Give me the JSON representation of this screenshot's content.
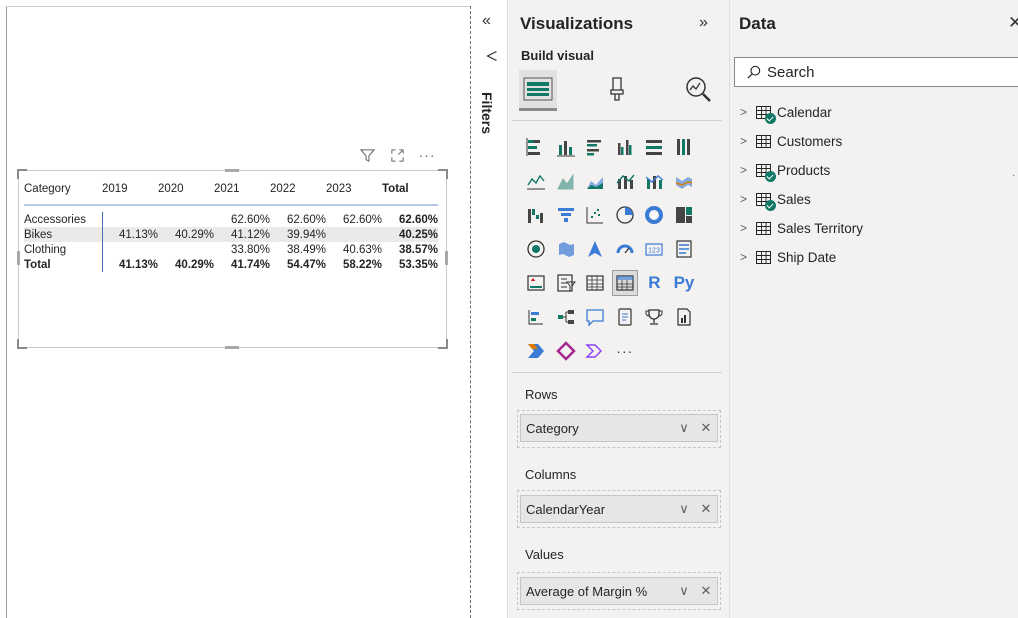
{
  "matrix": {
    "headers": [
      "Category",
      "2019",
      "2020",
      "2021",
      "2022",
      "2023",
      "Total"
    ],
    "rows": [
      {
        "label": "Accessories",
        "values": [
          "",
          "",
          "62.60%",
          "62.60%",
          "62.60%",
          "62.60%"
        ]
      },
      {
        "label": "Bikes",
        "values": [
          "41.13%",
          "40.29%",
          "41.12%",
          "39.94%",
          "",
          "40.25%"
        ]
      },
      {
        "label": "Clothing",
        "values": [
          "",
          "",
          "33.80%",
          "38.49%",
          "40.63%",
          "38.57%"
        ]
      },
      {
        "label": "Total",
        "values": [
          "41.13%",
          "40.29%",
          "41.74%",
          "54.47%",
          "58.22%",
          "53.35%"
        ]
      }
    ]
  },
  "filters": {
    "label": "Filters"
  },
  "visualizations": {
    "title": "Visualizations",
    "build_label": "Build visual",
    "icons": [
      "stacked-bar-icon",
      "stacked-column-icon",
      "clustered-bar-icon",
      "clustered-column-icon",
      "100-stacked-bar-icon",
      "100-stacked-column-icon",
      "line-chart-icon",
      "area-chart-icon",
      "stacked-area-icon",
      "line-clustered-column-icon",
      "line-stacked-column-icon",
      "ribbon-chart-icon",
      "waterfall-icon",
      "funnel-icon",
      "scatter-icon",
      "pie-chart-icon",
      "donut-chart-icon",
      "treemap-icon",
      "map-icon",
      "filled-map-icon",
      "azure-map-icon",
      "gauge-icon",
      "card-icon",
      "multi-row-card-icon",
      "kpi-icon",
      "slicer-icon",
      "table-icon",
      "matrix-icon",
      "r-visual-icon",
      "python-visual-icon",
      "key-influencers-icon",
      "decomposition-tree-icon",
      "qa-icon",
      "smart-narrative-icon",
      "goals-icon",
      "paginated-report-icon",
      "power-automate-icon",
      "power-apps-icon",
      "arrow-visual-icon",
      "more-visuals-icon"
    ],
    "r_text": "R",
    "py_text": "Py",
    "more_text": "···",
    "wells": {
      "rows_label": "Rows",
      "rows_field": "Category",
      "columns_label": "Columns",
      "columns_field": "CalendarYear",
      "values_label": "Values",
      "values_field": "Average of Margin %"
    }
  },
  "data_pane": {
    "title": "Data",
    "search_placeholder": "Search",
    "tables": [
      "Calendar",
      "Customers",
      "Products",
      "Sales",
      "Sales Territory",
      "Ship Date"
    ]
  },
  "colors": {
    "accent": "#117865",
    "pane_bg": "#f3f2f1",
    "selection_border": "#b7c9e5"
  }
}
